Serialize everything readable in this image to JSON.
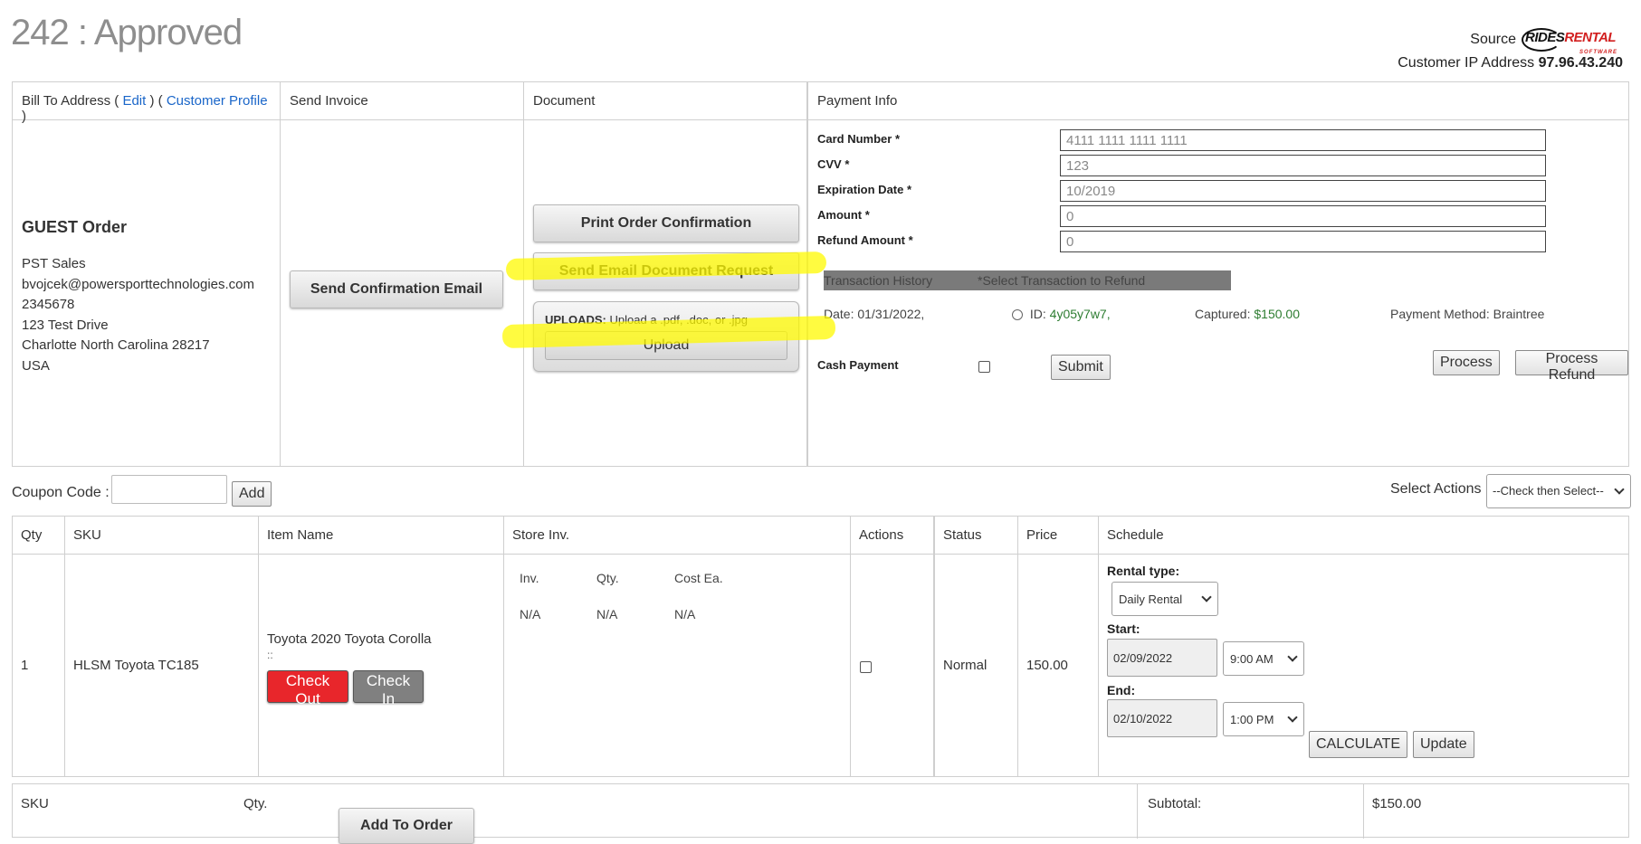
{
  "page": {
    "title": "242 : Approved",
    "source_label": "Source",
    "logo_text_1": "RIDES",
    "logo_text_2": "RENTAL",
    "logo_sub": "SOFTWARE",
    "ip_label": "Customer IP Address",
    "ip_value": "97.96.43.240"
  },
  "headers": {
    "bill_to": "Bill To Address (",
    "edit_link": "Edit",
    "between": ") (",
    "customer_profile_link": "Customer Profile",
    "close": ")",
    "send_invoice": "Send Invoice",
    "document": "Document",
    "payment_info": "Payment Info"
  },
  "bill": {
    "guest_title": "GUEST Order",
    "lines": [
      "PST Sales",
      "bvojcek@powersporttechnologies.com",
      "2345678",
      "123 Test Drive",
      "Charlotte North Carolina 28217",
      "USA"
    ]
  },
  "send_invoice": {
    "confirm_button": "Send Confirmation Email"
  },
  "document": {
    "print_button": "Print Order Confirmation",
    "email_doc_button": "Send Email Document Request",
    "uploads_label": "UPLOADS:",
    "uploads_hint": "Upload a .pdf, .doc, or .jpg",
    "upload_button": "Upload"
  },
  "payment": {
    "fields": [
      {
        "label": "Card Number *",
        "value": "4111 1111 1111 1111"
      },
      {
        "label": "CVV *",
        "value": "123"
      },
      {
        "label": "Expiration Date *",
        "value": "10/2019"
      },
      {
        "label": "Amount *",
        "value": "0"
      },
      {
        "label": "Refund Amount *",
        "value": "0"
      }
    ],
    "transaction_history": "Transaction History",
    "select_refund_hint": "*Select Transaction to Refund",
    "txn": {
      "date": "Date: 01/31/2022,",
      "id_label": "ID:",
      "id_value": "4y05y7w7,",
      "captured_label": "Captured:",
      "captured_value": "$150.00",
      "method": "Payment Method: Braintree"
    },
    "process_button": "Process",
    "refund_button": "Process Refund",
    "cash_label": "Cash Payment",
    "submit_button": "Submit"
  },
  "coupon": {
    "label": "Coupon Code :",
    "add_button": "Add",
    "select_actions_label": "Select Actions",
    "select_actions_value": "--Check then Select--"
  },
  "items": {
    "headers": [
      "Qty",
      "SKU",
      "Item Name",
      "Store Inv.",
      "Actions",
      "Status",
      "Price",
      "Schedule"
    ],
    "row": {
      "qty": "1",
      "sku": "HLSM Toyota TC185",
      "item_name": "Toyota 2020 Toyota Corolla",
      "item_sub": "::",
      "check_out": "Check Out",
      "check_in": "Check In",
      "inv_headers": [
        "Inv.",
        "Qty.",
        "Cost Ea."
      ],
      "inv_values": [
        "N/A",
        "N/A",
        "N/A"
      ],
      "status": "Normal",
      "price": "150.00",
      "rental_type_label": "Rental type:",
      "rental_type": "Daily Rental",
      "start_label": "Start:",
      "start_date": "02/09/2022",
      "start_time": "9:00 AM",
      "end_label": "End:",
      "end_date": "02/10/2022",
      "end_time": "1:00 PM",
      "calculate_button": "CALCULATE",
      "update_button": "Update"
    }
  },
  "bottom": {
    "sku_label": "SKU",
    "qty_label": "Qty.",
    "add_to_order_button": "Add To Order",
    "subtotal_label": "Subtotal:",
    "subtotal_value": "$150.00"
  },
  "colors": {
    "highlight": "#fffa00",
    "link": "#1a66c9",
    "check_out": "#e8262b",
    "check_in": "#808080",
    "green": "#2e7d32"
  }
}
